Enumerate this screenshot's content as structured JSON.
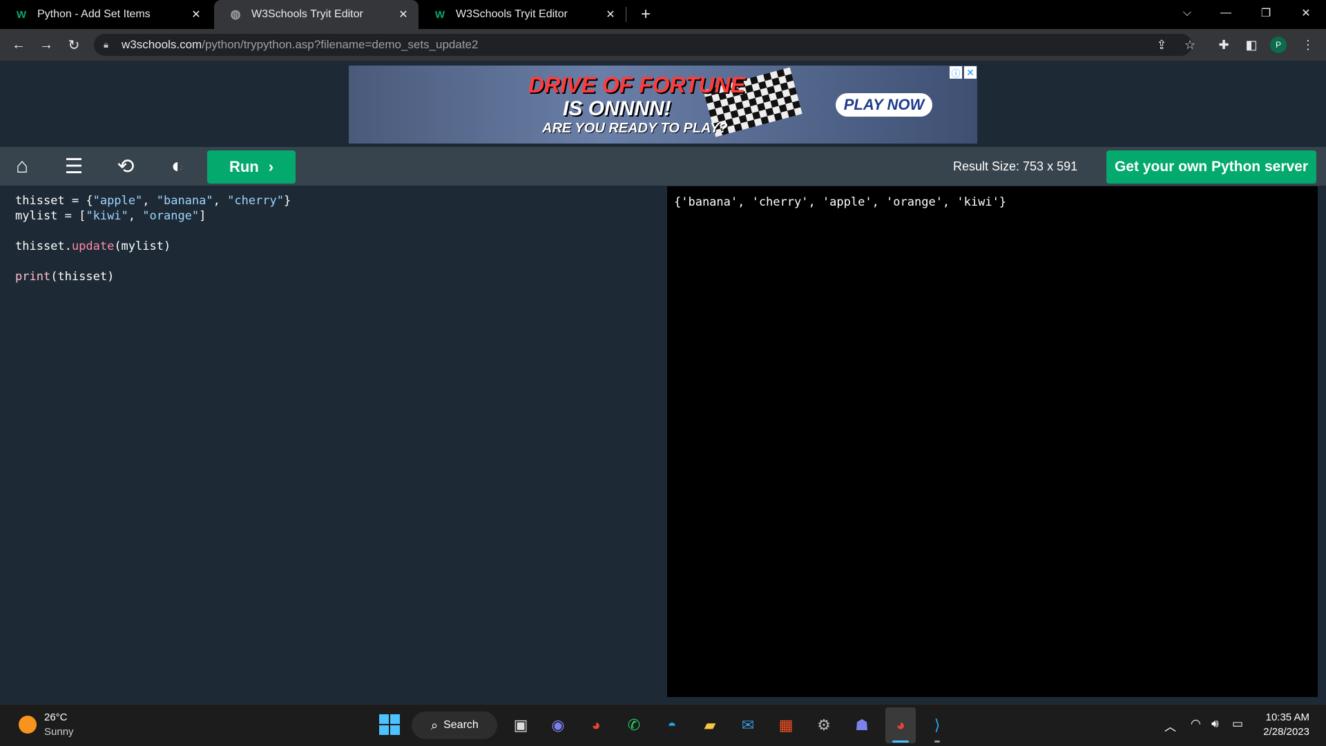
{
  "browser": {
    "tabs": [
      {
        "title": "Python - Add Set Items",
        "favicon": "w3schools-icon",
        "active": false
      },
      {
        "title": "W3Schools Tryit Editor",
        "favicon": "globe-icon",
        "active": true
      },
      {
        "title": "W3Schools Tryit Editor",
        "favicon": "w3schools-icon",
        "active": false
      }
    ],
    "url_host": "w3schools.com",
    "url_path": "/python/trypython.asp?filename=demo_sets_update2",
    "profile_initial": "P"
  },
  "ad": {
    "headline_1": "DRIVE OF FORTUNE",
    "headline_2": "IS ONNNN!",
    "tagline": "ARE YOU READY TO PLAY?",
    "cta": "PLAY NOW"
  },
  "editor": {
    "run_label": "Run",
    "result_size": "Result Size: 753 x 591",
    "server_button": "Get your own Python server",
    "code_lines": [
      "thisset = {\"apple\", \"banana\", \"cherry\"}",
      "mylist = [\"kiwi\", \"orange\"]",
      "",
      "thisset.update(mylist)",
      "",
      "print(thisset)"
    ],
    "output": "{'banana', 'cherry', 'apple', 'orange', 'kiwi'}"
  },
  "taskbar": {
    "weather_temp": "26°C",
    "weather_desc": "Sunny",
    "search_label": "Search",
    "time": "10:35 AM",
    "date": "2/28/2023"
  },
  "colors": {
    "accent": "#04aa6d",
    "editor_bg": "#1d2a35",
    "toolbar_bg": "#38444d",
    "result_bg": "#000000"
  }
}
